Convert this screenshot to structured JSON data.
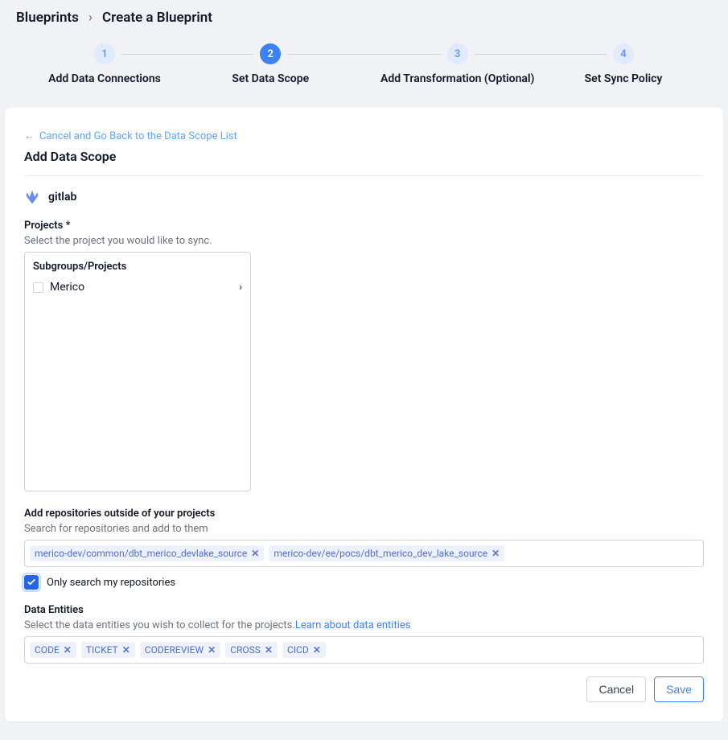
{
  "breadcrumb": {
    "parent": "Blueprints",
    "current": "Create a Blueprint"
  },
  "stepper": [
    {
      "num": "1",
      "label": "Add Data Connections",
      "active": false
    },
    {
      "num": "2",
      "label": "Set Data Scope",
      "active": true
    },
    {
      "num": "3",
      "label": "Add Transformation (Optional)",
      "active": false
    },
    {
      "num": "4",
      "label": "Set Sync Policy",
      "active": false
    }
  ],
  "back_link": "Cancel and Go Back to the Data Scope List",
  "card_title": "Add Data Scope",
  "connection": {
    "name": "gitlab"
  },
  "projects": {
    "label": "Projects *",
    "help": "Select the project you would like to sync.",
    "tree_header": "Subgroups/Projects",
    "items": [
      {
        "label": "Merico",
        "has_children": true
      }
    ]
  },
  "outside_repos": {
    "label": "Add repositories outside of your projects",
    "help": "Search for repositories and add to them",
    "tags": [
      "merico-dev/common/dbt_merico_devlake_source",
      "merico-dev/ee/pocs/dbt_merico_dev_lake_source"
    ],
    "checkbox_label": "Only search my repositories",
    "checkbox_checked": true
  },
  "entities": {
    "label": "Data Entities",
    "help": "Select the data entities you wish to collect for the projects.",
    "learn_link": "Learn about data entities",
    "tags": [
      "CODE",
      "TICKET",
      "CODEREVIEW",
      "CROSS",
      "CICD"
    ]
  },
  "actions": {
    "cancel": "Cancel",
    "save": "Save"
  }
}
